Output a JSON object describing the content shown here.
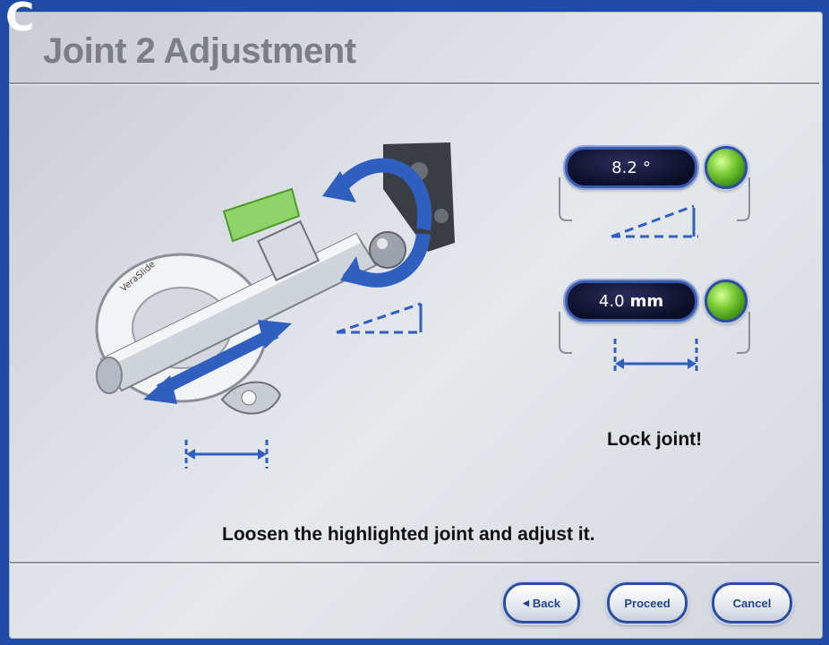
{
  "panel_label": "C",
  "window": {
    "title": "Joint 2 Adjustment"
  },
  "readouts": [
    {
      "value": "8.2",
      "unit": "°",
      "status": "green-lamp"
    },
    {
      "value": "4.0",
      "unit": "mm",
      "status": "green-lamp"
    }
  ],
  "lock_message": "Lock joint!",
  "instruction": "Loosen the highlighted joint and adjust it.",
  "buttons": {
    "back": "Back",
    "proceed": "Proceed",
    "cancel": "Cancel"
  },
  "colors": {
    "frame_blue": "#1f4aa6",
    "accent_blue": "#2c4e9e",
    "status_green": "#7fcf3a",
    "knob_green": "#8fd468"
  }
}
